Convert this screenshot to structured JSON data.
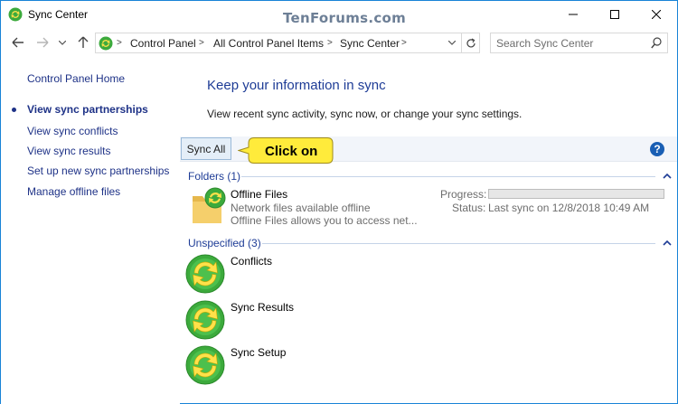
{
  "window": {
    "title": "Sync Center",
    "watermark": "TenForums.com"
  },
  "nav": {
    "breadcrumbs": [
      "Control Panel",
      "All Control Panel Items",
      "Sync Center"
    ],
    "search_placeholder": "Search Sync Center"
  },
  "sidebar": {
    "home": "Control Panel Home",
    "items": [
      {
        "label": "View sync partnerships",
        "active": true
      },
      {
        "label": "View sync conflicts",
        "active": false
      },
      {
        "label": "View sync results",
        "active": false
      },
      {
        "label": "Set up new sync partnerships",
        "active": false
      },
      {
        "label": "Manage offline files",
        "active": false
      }
    ]
  },
  "main": {
    "heading": "Keep your information in sync",
    "subtext": "View recent sync activity, sync now, or change your sync settings.",
    "toolbar": {
      "sync_all": "Sync All",
      "help": "?"
    },
    "callout": "Click on",
    "folders_group": {
      "header": "Folders (1)",
      "item": {
        "name": "Offline Files",
        "line1": "Network files available offline",
        "line2": "Offline Files allows you to access net...",
        "progress_label": "Progress:",
        "progress_value": 0,
        "status_label": "Status:",
        "status_value": "Last sync on 12/8/2018 10:49 AM"
      }
    },
    "unspecified_group": {
      "header": "Unspecified (3)",
      "items": [
        "Conflicts",
        "Sync Results",
        "Sync Setup"
      ]
    }
  },
  "colors": {
    "accent": "#1883d7",
    "link": "#1e3287",
    "heading": "#1e3c96",
    "sync_green": "#3caa3c",
    "callout_yellow": "#ffeb3b"
  }
}
